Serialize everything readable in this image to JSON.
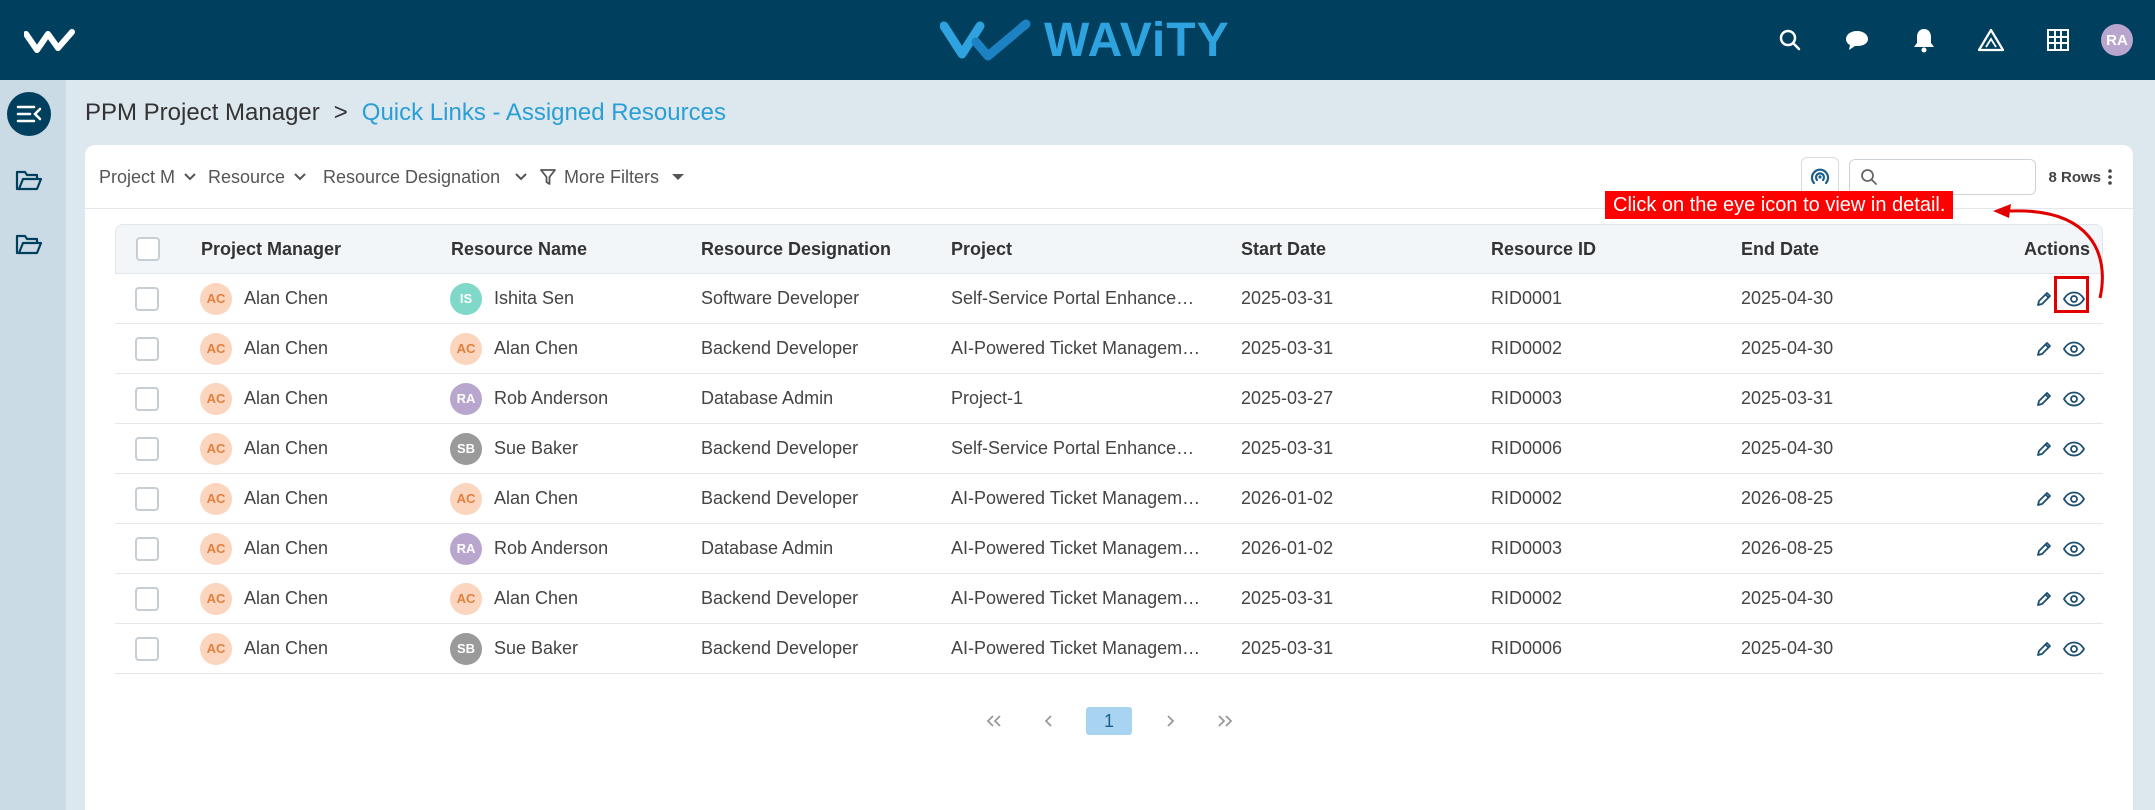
{
  "topbar": {
    "brand_name": "WAViTY",
    "user_initials": "RA",
    "icons": [
      "search-icon",
      "chat-icon",
      "bell-icon",
      "ai-triangle-icon",
      "apps-grid-icon"
    ]
  },
  "breadcrumb": {
    "root": "PPM Project Manager",
    "separator": ">",
    "current": "Quick Links - Assigned Resources"
  },
  "filters": {
    "project_manager": "Project M",
    "resource": "Resource",
    "resource_designation": "Resource Designation",
    "more_filters": "More Filters",
    "search_placeholder": "",
    "rows_count": "8 Rows"
  },
  "table": {
    "columns": [
      "Project Manager",
      "Resource Name",
      "Resource Designation",
      "Project",
      "Start Date",
      "Resource ID",
      "End Date",
      "Actions"
    ],
    "rows": [
      {
        "pm_initials": "AC",
        "pm": "Alan Chen",
        "res_initials": "IS",
        "res": "Ishita Sen",
        "designation": "Software Developer",
        "project": "Self-Service Portal Enhanceme...",
        "start": "2025-03-31",
        "rid": "RID0001",
        "end": "2025-04-30"
      },
      {
        "pm_initials": "AC",
        "pm": "Alan Chen",
        "res_initials": "AC",
        "res": "Alan Chen",
        "designation": "Backend Developer",
        "project": "AI-Powered Ticket Management",
        "start": "2025-03-31",
        "rid": "RID0002",
        "end": "2025-04-30"
      },
      {
        "pm_initials": "AC",
        "pm": "Alan Chen",
        "res_initials": "RA",
        "res": "Rob Anderson",
        "designation": "Database Admin",
        "project": "Project-1",
        "start": "2025-03-27",
        "rid": "RID0003",
        "end": "2025-03-31"
      },
      {
        "pm_initials": "AC",
        "pm": "Alan Chen",
        "res_initials": "SB",
        "res": "Sue Baker",
        "designation": "Backend Developer",
        "project": "Self-Service Portal Enhanceme...",
        "start": "2025-03-31",
        "rid": "RID0006",
        "end": "2025-04-30"
      },
      {
        "pm_initials": "AC",
        "pm": "Alan Chen",
        "res_initials": "AC",
        "res": "Alan Chen",
        "designation": "Backend Developer",
        "project": "AI-Powered Ticket Management",
        "start": "2026-01-02",
        "rid": "RID0002",
        "end": "2026-08-25"
      },
      {
        "pm_initials": "AC",
        "pm": "Alan Chen",
        "res_initials": "RA",
        "res": "Rob Anderson",
        "designation": "Database Admin",
        "project": "AI-Powered Ticket Management",
        "start": "2026-01-02",
        "rid": "RID0003",
        "end": "2026-08-25"
      },
      {
        "pm_initials": "AC",
        "pm": "Alan Chen",
        "res_initials": "AC",
        "res": "Alan Chen",
        "designation": "Backend Developer",
        "project": "AI-Powered Ticket Management",
        "start": "2025-03-31",
        "rid": "RID0002",
        "end": "2025-04-30"
      },
      {
        "pm_initials": "AC",
        "pm": "Alan Chen",
        "res_initials": "SB",
        "res": "Sue Baker",
        "designation": "Backend Developer",
        "project": "AI-Powered Ticket Management",
        "start": "2025-03-31",
        "rid": "RID0006",
        "end": "2025-04-30"
      }
    ]
  },
  "avatar_colors": {
    "AC": {
      "bg": "#fbd5bd",
      "fg": "#e0803f"
    },
    "IS": {
      "bg": "#7fd8c8",
      "fg": "#ffffff"
    },
    "RA": {
      "bg": "#b9a6cf",
      "fg": "#ffffff"
    },
    "SB": {
      "bg": "#9a9a9a",
      "fg": "#ffffff"
    }
  },
  "pagination": {
    "first": "«",
    "prev": "‹",
    "current_page": "1",
    "next": "›",
    "last": "»"
  },
  "annotation": {
    "callout_text": "Click on the eye icon to view in detail."
  },
  "colors": {
    "topbar": "#00405e",
    "accent": "#2a9fd6",
    "callout": "#ff0000"
  }
}
